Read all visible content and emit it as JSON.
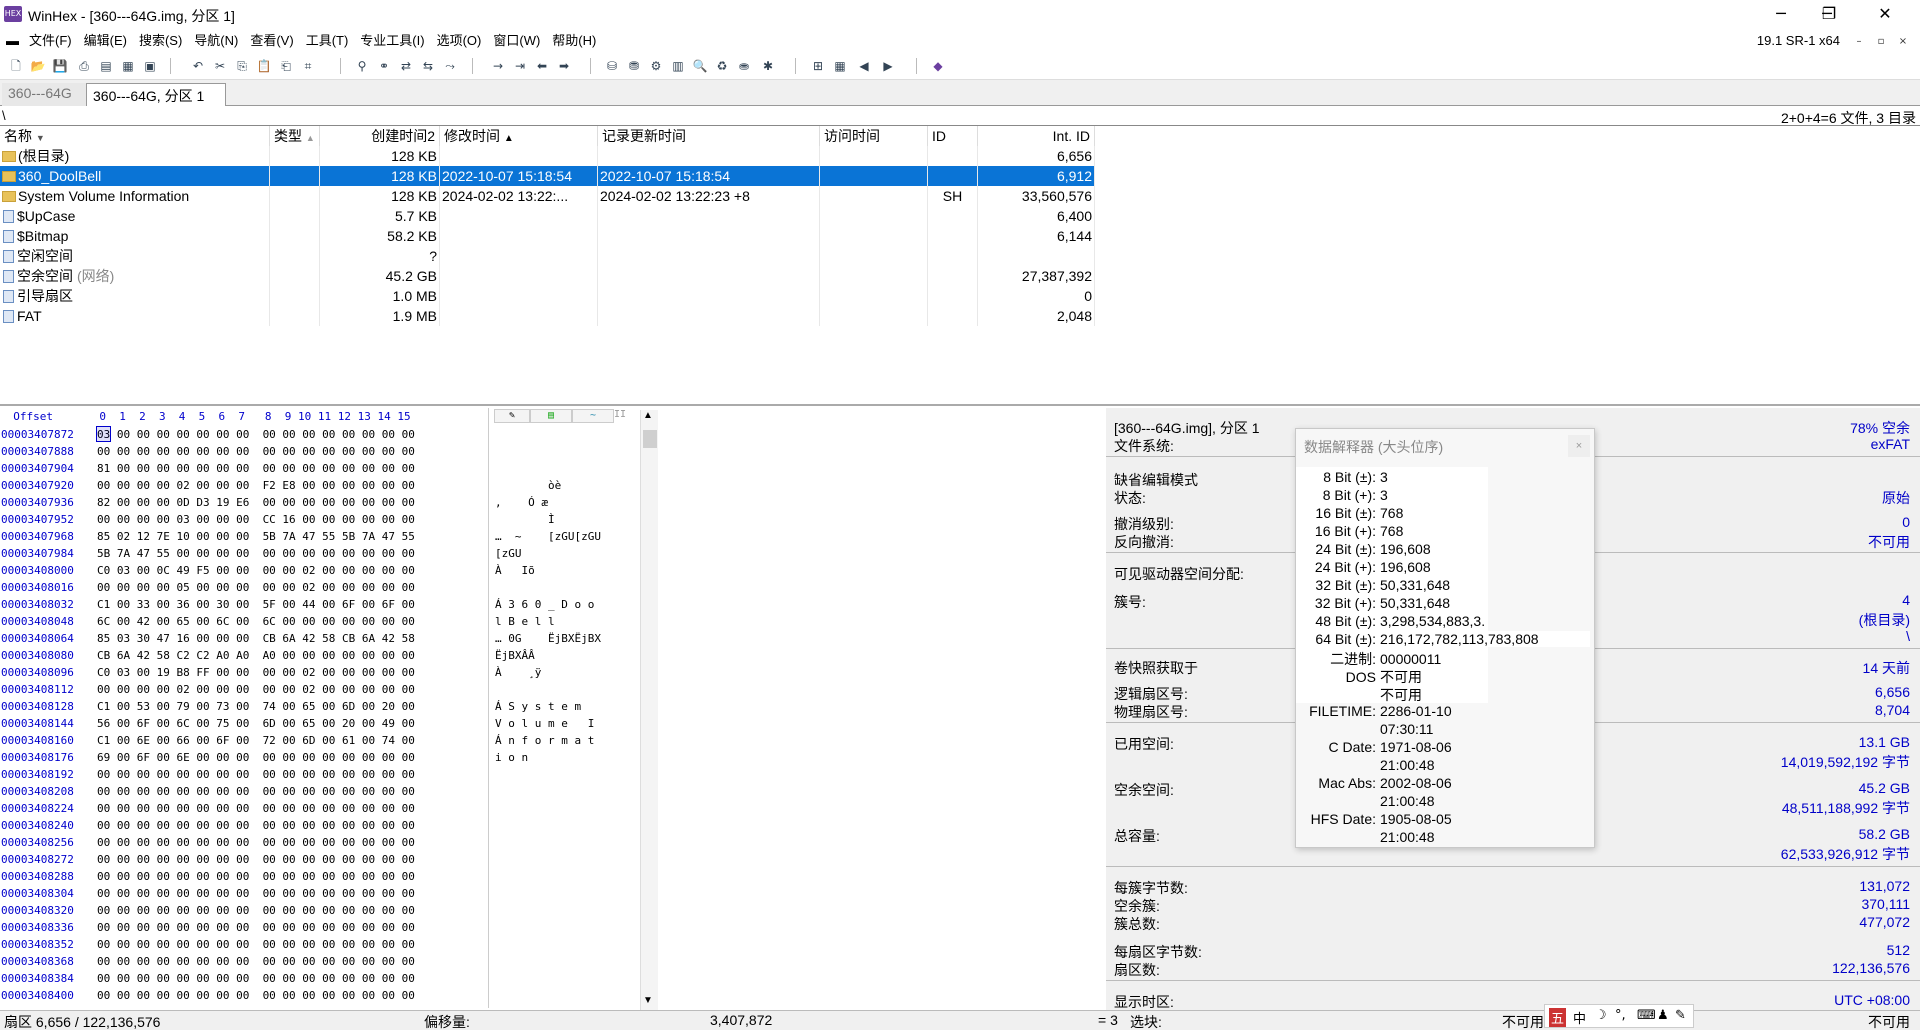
{
  "window": {
    "title": "WinHex - [360---64G.img, 分区 1]",
    "icon_label": "HEX",
    "version": "19.1 SR-1 x64",
    "controls": {
      "minimize": "─",
      "restore": "❐",
      "close": "✕",
      "mdi_min": "–",
      "mdi_restore": "▫",
      "mdi_close": "×"
    }
  },
  "menu": [
    "文件(F)",
    "编辑(E)",
    "搜索(S)",
    "导航(N)",
    "查看(V)",
    "工具(T)",
    "专业工具(I)",
    "选项(O)",
    "窗口(W)",
    "帮助(H)"
  ],
  "tabs": [
    {
      "label": "360---64G",
      "active": false
    },
    {
      "label": "360---64G, 分区 1",
      "active": true
    }
  ],
  "path": "\\",
  "file_count": "2+0+4=6 文件, 3 目录",
  "dir_columns": [
    "名称",
    "类型",
    "创建时间2",
    "修改时间",
    "记录更新时间",
    "访问时间",
    "ID",
    "Int. ID"
  ],
  "dir_rows": [
    {
      "icon": "folder",
      "name": "(根目录)",
      "note": "",
      "size": "128 KB",
      "modified": "",
      "record": "",
      "id": "",
      "intid": "6,656",
      "selected": false
    },
    {
      "icon": "folder",
      "name": "360_DoolBell",
      "note": "",
      "size": "128 KB",
      "modified": "2022-10-07  15:18:54",
      "record": "2022-10-07  15:18:54",
      "id": "",
      "intid": "6,912",
      "selected": true
    },
    {
      "icon": "folder",
      "name": "System Volume Information",
      "note": "",
      "size": "128 KB",
      "modified": "2024-02-02  13:22:...",
      "record": "2024-02-02  13:22:23  +8",
      "id": "SH",
      "intid": "33,560,576",
      "selected": false
    },
    {
      "icon": "file",
      "name": "$UpCase",
      "note": "",
      "size": "5.7 KB",
      "modified": "",
      "record": "",
      "id": "",
      "intid": "6,400",
      "selected": false
    },
    {
      "icon": "file",
      "name": "$Bitmap",
      "note": "",
      "size": "58.2 KB",
      "modified": "",
      "record": "",
      "id": "",
      "intid": "6,144",
      "selected": false
    },
    {
      "icon": "file",
      "name": "空闲空间",
      "note": "",
      "size": "?",
      "modified": "",
      "record": "",
      "id": "",
      "intid": "",
      "selected": false
    },
    {
      "icon": "file",
      "name": "空余空间",
      "note": "(网络)",
      "size": "45.2 GB",
      "modified": "",
      "record": "",
      "id": "",
      "intid": "27,387,392",
      "selected": false
    },
    {
      "icon": "file",
      "name": "引导扇区",
      "note": "",
      "size": "1.0 MB",
      "modified": "",
      "record": "",
      "id": "",
      "intid": "0",
      "selected": false
    },
    {
      "icon": "file",
      "name": "FAT",
      "note": "",
      "size": "1.9 MB",
      "modified": "",
      "record": "",
      "id": "",
      "intid": "2,048",
      "selected": false
    }
  ],
  "hex_header": "  Offset       0  1  2  3  4  5  6  7   8  9 10 11 12 13 14 15",
  "hex_rows": [
    {
      "off": "00003407872",
      "bytes": "03 00 00 00 00 00 00 00  00 00 00 00 00 00 00 00",
      "ascii": ""
    },
    {
      "off": "00003407888",
      "bytes": "00 00 00 00 00 00 00 00  00 00 00 00 00 00 00 00",
      "ascii": ""
    },
    {
      "off": "00003407904",
      "bytes": "81 00 00 00 00 00 00 00  00 00 00 00 00 00 00 00",
      "ascii": ""
    },
    {
      "off": "00003407920",
      "bytes": "00 00 00 00 02 00 00 00  F2 E8 00 00 00 00 00 00",
      "ascii": "        òè"
    },
    {
      "off": "00003407936",
      "bytes": "82 00 00 00 0D D3 19 E6  00 00 00 00 00 00 00 00",
      "ascii": ",    Ó æ"
    },
    {
      "off": "00003407952",
      "bytes": "00 00 00 00 03 00 00 00  CC 16 00 00 00 00 00 00",
      "ascii": "        Ì"
    },
    {
      "off": "00003407968",
      "bytes": "85 02 12 7E 10 00 00 00  5B 7A 47 55 5B 7A 47 55",
      "ascii": "…  ~    [zGU[zGU"
    },
    {
      "off": "00003407984",
      "bytes": "5B 7A 47 55 00 00 00 00  00 00 00 00 00 00 00 00",
      "ascii": "[zGU"
    },
    {
      "off": "00003408000",
      "bytes": "C0 03 00 0C 49 F5 00 00  00 00 02 00 00 00 00 00",
      "ascii": "À   Iõ"
    },
    {
      "off": "00003408016",
      "bytes": "00 00 00 00 05 00 00 00  00 00 02 00 00 00 00 00",
      "ascii": ""
    },
    {
      "off": "00003408032",
      "bytes": "C1 00 33 00 36 00 30 00  5F 00 44 00 6F 00 6F 00",
      "ascii": "Á 3 6 0 _ D o o"
    },
    {
      "off": "00003408048",
      "bytes": "6C 00 42 00 65 00 6C 00  6C 00 00 00 00 00 00 00",
      "ascii": "l B e l l"
    },
    {
      "off": "00003408064",
      "bytes": "85 03 30 47 16 00 00 00  CB 6A 42 58 CB 6A 42 58",
      "ascii": "… 0G    ËjBXËjBX"
    },
    {
      "off": "00003408080",
      "bytes": "CB 6A 42 58 C2 C2 A0 A0  A0 00 00 00 00 00 00 00",
      "ascii": "ËjBXÂÂ"
    },
    {
      "off": "00003408096",
      "bytes": "C0 03 00 19 B8 FF 00 00  00 00 02 00 00 00 00 00",
      "ascii": "À    ¸ÿ"
    },
    {
      "off": "00003408112",
      "bytes": "00 00 00 00 02 00 00 00  00 00 02 00 00 00 00 00",
      "ascii": ""
    },
    {
      "off": "00003408128",
      "bytes": "C1 00 53 00 79 00 73 00  74 00 65 00 6D 00 20 00",
      "ascii": "Á S y s t e m"
    },
    {
      "off": "00003408144",
      "bytes": "56 00 6F 00 6C 00 75 00  6D 00 65 00 20 00 49 00",
      "ascii": "V o l u m e   I"
    },
    {
      "off": "00003408160",
      "bytes": "C1 00 6E 00 66 00 6F 00  72 00 6D 00 61 00 74 00",
      "ascii": "Á n f o r m a t"
    },
    {
      "off": "00003408176",
      "bytes": "69 00 6F 00 6E 00 00 00  00 00 00 00 00 00 00 00",
      "ascii": "i o n"
    },
    {
      "off": "00003408192",
      "bytes": "00 00 00 00 00 00 00 00  00 00 00 00 00 00 00 00",
      "ascii": ""
    },
    {
      "off": "00003408208",
      "bytes": "00 00 00 00 00 00 00 00  00 00 00 00 00 00 00 00",
      "ascii": ""
    },
    {
      "off": "00003408224",
      "bytes": "00 00 00 00 00 00 00 00  00 00 00 00 00 00 00 00",
      "ascii": ""
    },
    {
      "off": "00003408240",
      "bytes": "00 00 00 00 00 00 00 00  00 00 00 00 00 00 00 00",
      "ascii": ""
    },
    {
      "off": "00003408256",
      "bytes": "00 00 00 00 00 00 00 00  00 00 00 00 00 00 00 00",
      "ascii": ""
    },
    {
      "off": "00003408272",
      "bytes": "00 00 00 00 00 00 00 00  00 00 00 00 00 00 00 00",
      "ascii": ""
    },
    {
      "off": "00003408288",
      "bytes": "00 00 00 00 00 00 00 00  00 00 00 00 00 00 00 00",
      "ascii": ""
    },
    {
      "off": "00003408304",
      "bytes": "00 00 00 00 00 00 00 00  00 00 00 00 00 00 00 00",
      "ascii": ""
    },
    {
      "off": "00003408320",
      "bytes": "00 00 00 00 00 00 00 00  00 00 00 00 00 00 00 00",
      "ascii": ""
    },
    {
      "off": "00003408336",
      "bytes": "00 00 00 00 00 00 00 00  00 00 00 00 00 00 00 00",
      "ascii": ""
    },
    {
      "off": "00003408352",
      "bytes": "00 00 00 00 00 00 00 00  00 00 00 00 00 00 00 00",
      "ascii": ""
    },
    {
      "off": "00003408368",
      "bytes": "00 00 00 00 00 00 00 00  00 00 00 00 00 00 00 00",
      "ascii": ""
    },
    {
      "off": "00003408384",
      "bytes": "00 00 00 00 00 00 00 00  00 00 00 00 00 00 00 00",
      "ascii": ""
    },
    {
      "off": "00003408400",
      "bytes": "00 00 00 00 00 00 00 00  00 00 00 00 00 00 00 00",
      "ascii": ""
    }
  ],
  "info": {
    "disk": "[360---64G.img], 分区 1",
    "free_pct": "78% 空余",
    "fs_label": "文件系统:",
    "fs": "exFAT",
    "edit_mode_label": "缺省编辑模式",
    "state_label": "状态:",
    "state": "原始",
    "undo_label": "撤消级别:",
    "undo": "0",
    "reverse_label": "反向撤消:",
    "reverse": "不可用",
    "alloc_label": "可见驱动器空间分配:",
    "cluster_label": "簇号:",
    "cluster": "4",
    "cluster_dir": "(根目录)",
    "cluster_path": "\\",
    "snapshot_label": "卷快照获取于",
    "snapshot": "14 天前",
    "logical_label": "逻辑扇区号:",
    "logical": "6,656",
    "physical_label": "物理扇区号:",
    "physical": "8,704",
    "used_label": "已用空间:",
    "used_gb": "13.1 GB",
    "used_bytes": "14,019,592,192 字节",
    "free_label": "空余空间:",
    "free_gb": "45.2 GB",
    "free_bytes": "48,511,188,992 字节",
    "total_label": "总容量:",
    "total_gb": "58.2 GB",
    "total_bytes": "62,533,926,912 字节",
    "bpc_label": "每簇字节数:",
    "bpc": "131,072",
    "freecl_label": "空余簇:",
    "freecl": "370,111",
    "totalcl_label": "簇总数:",
    "totalcl": "477,072",
    "bps_label": "每扇区字节数:",
    "bps": "512",
    "sectors_label": "扇区数:",
    "sectors": "122,136,576",
    "tz_label": "显示时区:",
    "tz": "UTC +08:00",
    "na": "不可用"
  },
  "interpreter": {
    "title": "数据解释器 (大头位序)",
    "close": "×",
    "rows": [
      {
        "k": "8 Bit (±):",
        "v": "3"
      },
      {
        "k": "8 Bit (+):",
        "v": "3"
      },
      {
        "k": "16 Bit (±):",
        "v": "768"
      },
      {
        "k": "16 Bit (+):",
        "v": "768"
      },
      {
        "k": "24 Bit (±):",
        "v": "196,608"
      },
      {
        "k": "24 Bit (+):",
        "v": "196,608"
      },
      {
        "k": "32 Bit (±):",
        "v": "50,331,648"
      },
      {
        "k": "32 Bit (+):",
        "v": "50,331,648"
      },
      {
        "k": "48 Bit (±):",
        "v": "3,298,534,883,3."
      },
      {
        "k": "64 Bit (±):",
        "v": "216,172,782,113,783,808"
      },
      {
        "k": "二进制:",
        "v": "00000011"
      },
      {
        "k": "DOS",
        "v": "不可用"
      },
      {
        "k": "",
        "v": "不可用"
      },
      {
        "k": "FILETIME:",
        "v": "2286-01-10"
      },
      {
        "k": "",
        "v": "07:30:11"
      },
      {
        "k": "C Date:",
        "v": "1971-08-06"
      },
      {
        "k": "",
        "v": "21:00:48"
      },
      {
        "k": "Mac Abs:",
        "v": "2002-08-06"
      },
      {
        "k": "",
        "v": "21:00:48"
      },
      {
        "k": "HFS Date:",
        "v": "1905-08-05"
      },
      {
        "k": "",
        "v": "21:00:48"
      }
    ]
  },
  "status": {
    "sector": "扇区 6,656 / 122,136,576",
    "offset_label": "偏移量:",
    "offset": "3,407,872",
    "value": "= 3",
    "block_label": "选块:",
    "na1": "不可用",
    "na2": "不可用"
  },
  "ime": [
    "五",
    "中",
    "☽",
    "°,",
    "⌨",
    "♟",
    "🔧"
  ]
}
